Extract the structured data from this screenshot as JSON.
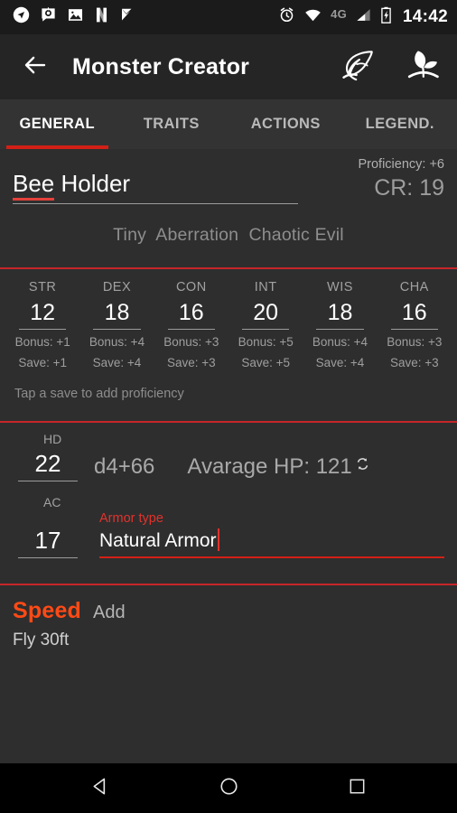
{
  "status_bar": {
    "left_icons": [
      "location-arrow-icon",
      "chat-bubble-icon",
      "photo-icon",
      "netflix-n-icon",
      "task-check-icon"
    ],
    "alarm_icon": "alarm-clock-icon",
    "wifi_icon": "wifi-icon",
    "network_label": "4G",
    "signal_icon": "cell-signal-icon",
    "battery_icon": "battery-charging-icon",
    "time": "14:42"
  },
  "app_bar": {
    "back_icon": "arrow-left-icon",
    "title": "Monster Creator",
    "actions": [
      {
        "icon": "feather-quill-icon"
      },
      {
        "icon": "sprout-plant-icon"
      }
    ]
  },
  "tabs": {
    "items": [
      {
        "label": "GENERAL",
        "active": true
      },
      {
        "label": "TRAITS",
        "active": false
      },
      {
        "label": "ACTIONS",
        "active": false
      },
      {
        "label": "LEGEND.",
        "active": false
      }
    ],
    "indicator_color": "#d32017"
  },
  "general": {
    "name": {
      "misspelled_part": "Bee",
      "rest": " Holder",
      "full_value": "Bee Holder"
    },
    "proficiency": "Proficiency: +6",
    "cr": "CR: 19",
    "subtitle": {
      "size": "Tiny",
      "type": "Aberration",
      "alignment": "Chaotic Evil"
    },
    "abilities": [
      {
        "label": "STR",
        "score": "12",
        "bonus": "Bonus: +1",
        "save": "Save: +1"
      },
      {
        "label": "DEX",
        "score": "18",
        "bonus": "Bonus: +4",
        "save": "Save: +4"
      },
      {
        "label": "CON",
        "score": "16",
        "bonus": "Bonus: +3",
        "save": "Save: +3"
      },
      {
        "label": "INT",
        "score": "20",
        "bonus": "Bonus: +5",
        "save": "Save: +5"
      },
      {
        "label": "WIS",
        "score": "18",
        "bonus": "Bonus: +4",
        "save": "Save: +4"
      },
      {
        "label": "CHA",
        "score": "16",
        "bonus": "Bonus: +3",
        "save": "Save: +3"
      }
    ],
    "save_hint": "Tap a save to add proficiency",
    "hit_dice": {
      "label": "HD",
      "count": "22",
      "die_formula": "d4+66",
      "average_hp": "Avarage HP: 121",
      "reroll_icon": "refresh-reroll-icon"
    },
    "armor": {
      "ac_label": "AC",
      "ac_value": "17",
      "armor_type_label": "Armor type",
      "armor_type_value": "Natural Armor"
    },
    "speed": {
      "title": "Speed",
      "add_label": "Add",
      "entries": [
        "Fly 30ft"
      ]
    }
  },
  "nav_bar": {
    "back_icon": "nav-back-triangle-icon",
    "home_icon": "nav-home-circle-icon",
    "recents_icon": "nav-recents-square-icon"
  },
  "colors": {
    "accent_red": "#d32017",
    "speed_orange": "#ff4a15",
    "background": "#2e2e2e",
    "appbar": "#252525",
    "tabbar": "#333333"
  }
}
